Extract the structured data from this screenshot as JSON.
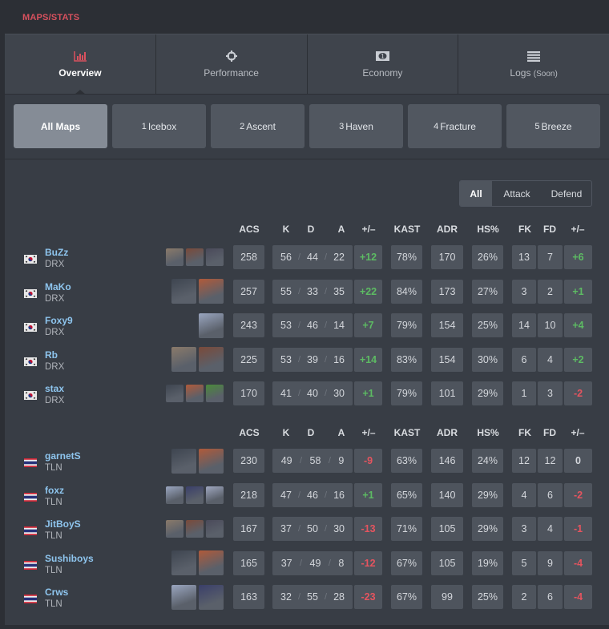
{
  "page_label": "MAPS/STATS",
  "stat_tabs": [
    {
      "label": "Overview",
      "icon": "bar-chart-icon",
      "active": true
    },
    {
      "label": "Performance",
      "icon": "crosshair-icon",
      "active": false
    },
    {
      "label": "Economy",
      "icon": "money-icon",
      "active": false
    },
    {
      "label": "Logs",
      "suffix": "(Soon)",
      "icon": "list-icon",
      "active": false
    }
  ],
  "maps": [
    {
      "num": "",
      "label": "All Maps",
      "active": true
    },
    {
      "num": "1",
      "label": "Icebox",
      "active": false
    },
    {
      "num": "2",
      "label": "Ascent",
      "active": false
    },
    {
      "num": "3",
      "label": "Haven",
      "active": false
    },
    {
      "num": "4",
      "label": "Fracture",
      "active": false
    },
    {
      "num": "5",
      "label": "Breeze",
      "active": false
    }
  ],
  "side_filter": {
    "all": "All",
    "attack": "Attack",
    "defend": "Defend",
    "selected": "All"
  },
  "columns": {
    "acs": "ACS",
    "k": "K",
    "d": "D",
    "a": "A",
    "pm": "+/–",
    "kast": "KAST",
    "adr": "ADR",
    "hs": "HS%",
    "fk": "FK",
    "fd": "FD",
    "fpm": "+/–"
  },
  "colors": {
    "positive": "#5dbb63",
    "negative": "#e5545f",
    "accent": "#d9515e",
    "player_name": "#8ec5ee"
  },
  "teams": [
    {
      "tag": "DRX",
      "flag": "south-korea-flag",
      "players": [
        {
          "name": "BuZz",
          "team": "DRX",
          "agents": [
            "agent-1",
            "agent-2",
            "agent-3"
          ],
          "acs": "258",
          "k": "56",
          "d": "44",
          "a": "22",
          "pm": "+12",
          "kast": "78%",
          "adr": "170",
          "hs": "26%",
          "fk": "13",
          "fd": "7",
          "fpm": "+6"
        },
        {
          "name": "MaKo",
          "team": "DRX",
          "agents": [
            "agent-1",
            "agent-2"
          ],
          "acs": "257",
          "k": "55",
          "d": "33",
          "a": "35",
          "pm": "+22",
          "kast": "84%",
          "adr": "173",
          "hs": "27%",
          "fk": "3",
          "fd": "2",
          "fpm": "+1"
        },
        {
          "name": "Foxy9",
          "team": "DRX",
          "agents": [
            "agent-1"
          ],
          "acs": "243",
          "k": "53",
          "d": "46",
          "a": "14",
          "pm": "+7",
          "kast": "79%",
          "adr": "154",
          "hs": "25%",
          "fk": "14",
          "fd": "10",
          "fpm": "+4"
        },
        {
          "name": "Rb",
          "team": "DRX",
          "agents": [
            "agent-1",
            "agent-2"
          ],
          "acs": "225",
          "k": "53",
          "d": "39",
          "a": "16",
          "pm": "+14",
          "kast": "83%",
          "adr": "154",
          "hs": "30%",
          "fk": "6",
          "fd": "4",
          "fpm": "+2"
        },
        {
          "name": "stax",
          "team": "DRX",
          "agents": [
            "agent-1",
            "agent-2",
            "agent-3"
          ],
          "acs": "170",
          "k": "41",
          "d": "40",
          "a": "30",
          "pm": "+1",
          "kast": "79%",
          "adr": "101",
          "hs": "29%",
          "fk": "1",
          "fd": "3",
          "fpm": "-2"
        }
      ]
    },
    {
      "tag": "TLN",
      "flag": "thailand-flag",
      "players": [
        {
          "name": "garnetS",
          "team": "TLN",
          "agents": [
            "agent-1",
            "agent-2"
          ],
          "acs": "230",
          "k": "49",
          "d": "58",
          "a": "9",
          "pm": "-9",
          "kast": "63%",
          "adr": "146",
          "hs": "24%",
          "fk": "12",
          "fd": "12",
          "fpm": "0"
        },
        {
          "name": "foxz",
          "team": "TLN",
          "agents": [
            "agent-1",
            "agent-2",
            "agent-3"
          ],
          "acs": "218",
          "k": "47",
          "d": "46",
          "a": "16",
          "pm": "+1",
          "kast": "65%",
          "adr": "140",
          "hs": "29%",
          "fk": "4",
          "fd": "6",
          "fpm": "-2"
        },
        {
          "name": "JitBoyS",
          "team": "TLN",
          "agents": [
            "agent-1",
            "agent-2",
            "agent-3"
          ],
          "acs": "167",
          "k": "37",
          "d": "50",
          "a": "30",
          "pm": "-13",
          "kast": "71%",
          "adr": "105",
          "hs": "29%",
          "fk": "3",
          "fd": "4",
          "fpm": "-1"
        },
        {
          "name": "Sushiboys",
          "team": "TLN",
          "agents": [
            "agent-1",
            "agent-2"
          ],
          "acs": "165",
          "k": "37",
          "d": "49",
          "a": "8",
          "pm": "-12",
          "kast": "67%",
          "adr": "105",
          "hs": "19%",
          "fk": "5",
          "fd": "9",
          "fpm": "-4"
        },
        {
          "name": "Crws",
          "team": "TLN",
          "agents": [
            "agent-1",
            "agent-2"
          ],
          "acs": "163",
          "k": "32",
          "d": "55",
          "a": "28",
          "pm": "-23",
          "kast": "67%",
          "adr": "99",
          "hs": "25%",
          "fk": "2",
          "fd": "6",
          "fpm": "-4"
        }
      ]
    }
  ]
}
